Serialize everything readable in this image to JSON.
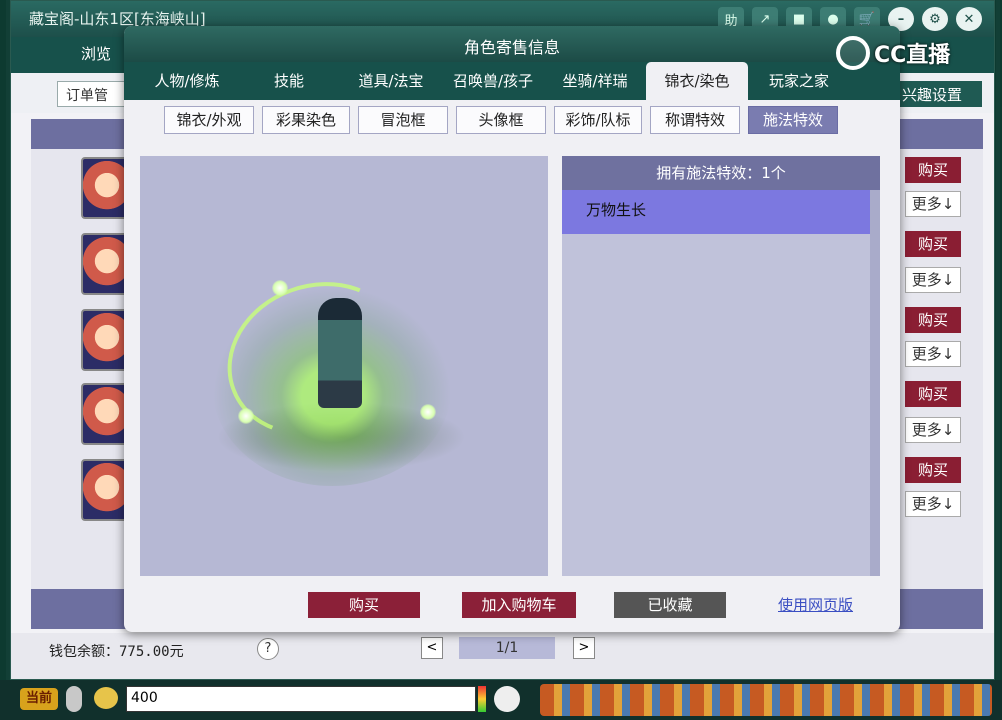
{
  "main_window": {
    "title": "藏宝阁-山东1区[东海峡山]",
    "nav_label": "浏览",
    "order_button": "订单管",
    "interest_button": "兴趣设置",
    "titlebar_icons": [
      "助",
      "↗",
      "■",
      "●",
      "🛒",
      "–",
      "⚙",
      "✕"
    ]
  },
  "rows": [
    {
      "buy": "购买",
      "more": "更多↓"
    },
    {
      "buy": "购买",
      "more": "更多↓"
    },
    {
      "buy": "购买",
      "more": "更多↓"
    },
    {
      "buy": "购买",
      "more": "更多↓"
    },
    {
      "buy": "购买",
      "more": "更多↓"
    }
  ],
  "footer": {
    "wallet": "钱包余额：775.00元",
    "help": "?",
    "prev": "<",
    "page": "1/1",
    "next": ">"
  },
  "dialog": {
    "title": "角色寄售信息",
    "tabs": [
      "人物/修炼",
      "技能",
      "道具/法宝",
      "召唤兽/孩子",
      "坐骑/祥瑞",
      "锦衣/染色",
      "玩家之家"
    ],
    "active_tab": 5,
    "subtabs": [
      "锦衣/外观",
      "彩果染色",
      "冒泡框",
      "头像框",
      "彩饰/队标",
      "称谓特效",
      "施法特效"
    ],
    "active_subtab": 6,
    "effects_header": "拥有施法特效：1个",
    "effects": [
      "万物生长"
    ],
    "buttons": {
      "buy": "购买",
      "add_to_cart": "加入购物车",
      "favorited": "已收藏",
      "use_web": "使用网页版"
    }
  },
  "chat": {
    "channel": "当前",
    "input_value": "400"
  },
  "watermark": {
    "text": "CC直播"
  }
}
